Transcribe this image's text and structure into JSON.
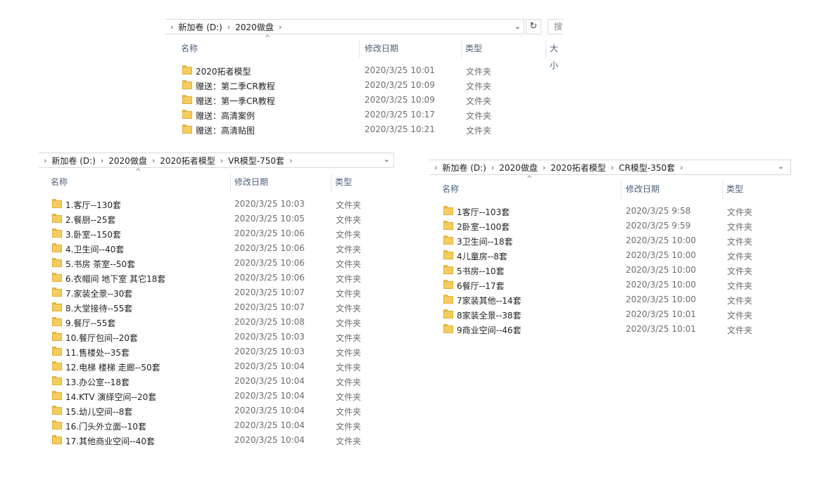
{
  "win1": {
    "breadcrumb": [
      "新加卷 (D:)",
      "2020做盘"
    ],
    "headers": {
      "name": "名称",
      "date": "修改日期",
      "type": "类型",
      "size": "大小"
    },
    "search_stub": "搜",
    "rows": [
      {
        "name": "2020拓者模型",
        "date": "2020/3/25 10:01",
        "type": "文件夹"
      },
      {
        "name": "赠送：第二季CR教程",
        "date": "2020/3/25 10:09",
        "type": "文件夹"
      },
      {
        "name": "赠送：第一季CR教程",
        "date": "2020/3/25 10:09",
        "type": "文件夹"
      },
      {
        "name": "赠送：高清案例",
        "date": "2020/3/25 10:17",
        "type": "文件夹"
      },
      {
        "name": "赠送：高清贴图",
        "date": "2020/3/25 10:21",
        "type": "文件夹"
      }
    ]
  },
  "win2": {
    "breadcrumb": [
      "新加卷 (D:)",
      "2020做盘",
      "2020拓者模型",
      "VR模型-750套"
    ],
    "headers": {
      "name": "名称",
      "date": "修改日期",
      "type": "类型"
    },
    "rows": [
      {
        "name": "1.客厅--130套",
        "date": "2020/3/25 10:03",
        "type": "文件夹"
      },
      {
        "name": "2.餐厨--25套",
        "date": "2020/3/25 10:05",
        "type": "文件夹"
      },
      {
        "name": "3.卧室--150套",
        "date": "2020/3/25 10:06",
        "type": "文件夹"
      },
      {
        "name": "4.卫生间--40套",
        "date": "2020/3/25 10:06",
        "type": "文件夹"
      },
      {
        "name": "5.书房 茶室--50套",
        "date": "2020/3/25 10:06",
        "type": "文件夹"
      },
      {
        "name": "6.衣帽间 地下室 其它18套",
        "date": "2020/3/25 10:06",
        "type": "文件夹"
      },
      {
        "name": "7.家装全景--30套",
        "date": "2020/3/25 10:07",
        "type": "文件夹"
      },
      {
        "name": "8.大堂接待--55套",
        "date": "2020/3/25 10:07",
        "type": "文件夹"
      },
      {
        "name": "9.餐厅--55套",
        "date": "2020/3/25 10:08",
        "type": "文件夹"
      },
      {
        "name": "10.餐厅包间--20套",
        "date": "2020/3/25 10:03",
        "type": "文件夹"
      },
      {
        "name": "11.售楼处--35套",
        "date": "2020/3/25 10:03",
        "type": "文件夹"
      },
      {
        "name": "12.电梯 楼梯 走廊--50套",
        "date": "2020/3/25 10:04",
        "type": "文件夹"
      },
      {
        "name": "13.办公室--18套",
        "date": "2020/3/25 10:04",
        "type": "文件夹"
      },
      {
        "name": "14.KTV 演绎空间--20套",
        "date": "2020/3/25 10:04",
        "type": "文件夹"
      },
      {
        "name": "15.幼儿空间--8套",
        "date": "2020/3/25 10:04",
        "type": "文件夹"
      },
      {
        "name": "16.门头外立面--10套",
        "date": "2020/3/25 10:04",
        "type": "文件夹"
      },
      {
        "name": "17.其他商业空间--40套",
        "date": "2020/3/25 10:04",
        "type": "文件夹"
      }
    ]
  },
  "win3": {
    "breadcrumb": [
      "新加卷 (D:)",
      "2020做盘",
      "2020拓者模型",
      "CR模型-350套"
    ],
    "headers": {
      "name": "名称",
      "date": "修改日期",
      "type": "类型"
    },
    "rows": [
      {
        "name": "1客厅--103套",
        "date": "2020/3/25 9:58",
        "type": "文件夹"
      },
      {
        "name": "2卧室--100套",
        "date": "2020/3/25 9:59",
        "type": "文件夹"
      },
      {
        "name": "3卫生间--18套",
        "date": "2020/3/25 10:00",
        "type": "文件夹"
      },
      {
        "name": "4儿童房--8套",
        "date": "2020/3/25 10:00",
        "type": "文件夹"
      },
      {
        "name": "5书房--10套",
        "date": "2020/3/25 10:00",
        "type": "文件夹"
      },
      {
        "name": "6餐厅--17套",
        "date": "2020/3/25 10:00",
        "type": "文件夹"
      },
      {
        "name": "7家装其他--14套",
        "date": "2020/3/25 10:00",
        "type": "文件夹"
      },
      {
        "name": "8家装全景--38套",
        "date": "2020/3/25 10:01",
        "type": "文件夹"
      },
      {
        "name": "9商业空间--46套",
        "date": "2020/3/25 10:01",
        "type": "文件夹"
      }
    ]
  }
}
